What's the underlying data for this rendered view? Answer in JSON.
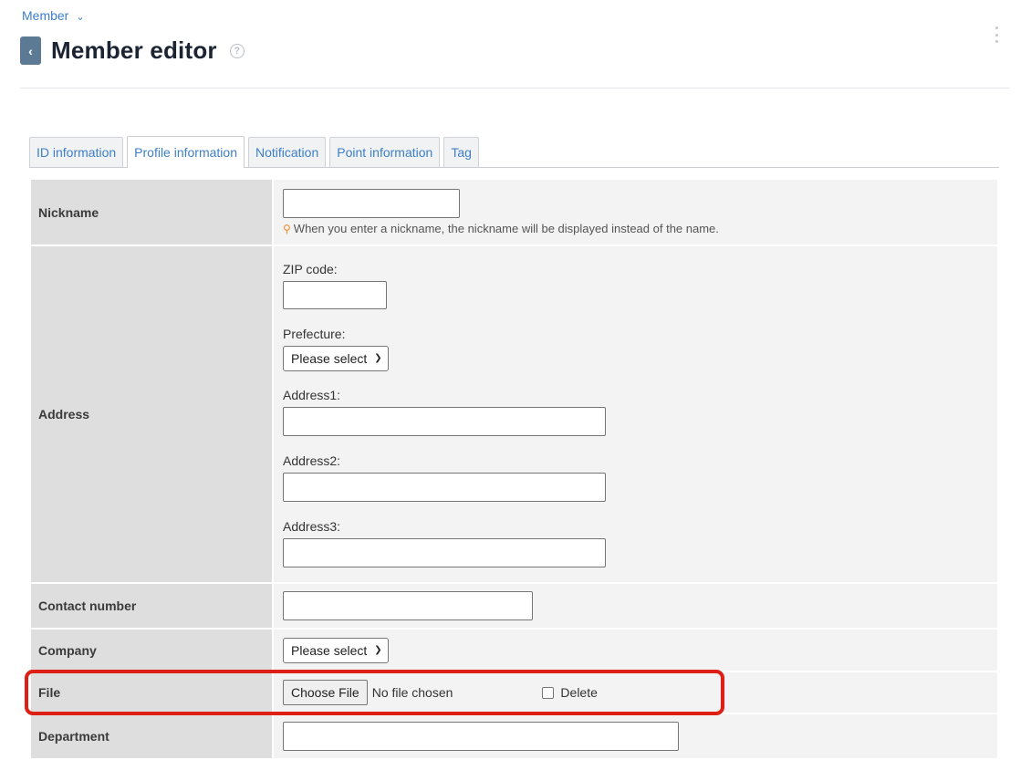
{
  "breadcrumb": {
    "label": "Member"
  },
  "page": {
    "title": "Member editor"
  },
  "tabs": [
    {
      "label": "ID information"
    },
    {
      "label": "Profile information"
    },
    {
      "label": "Notification"
    },
    {
      "label": "Point information"
    },
    {
      "label": "Tag"
    }
  ],
  "form": {
    "nickname": {
      "label": "Nickname",
      "value": "",
      "note": "When you enter a nickname, the nickname will be displayed instead of the name."
    },
    "address": {
      "label": "Address",
      "zip_label": "ZIP code:",
      "prefecture_label": "Prefecture:",
      "prefecture_value": "Please select",
      "address1_label": "Address1:",
      "address2_label": "Address2:",
      "address3_label": "Address3:"
    },
    "contact": {
      "label": "Contact number",
      "value": ""
    },
    "company": {
      "label": "Company",
      "value": "Please select"
    },
    "file": {
      "label": "File",
      "button_label": "Choose File",
      "status": "No file chosen",
      "delete_label": "Delete",
      "delete_checked": false
    },
    "department": {
      "label": "Department",
      "value": ""
    }
  },
  "colors": {
    "link": "#3d7fc9",
    "highlight": "#dd1f14",
    "label_bg": "#dedede",
    "field_bg": "#f3f3f3"
  }
}
